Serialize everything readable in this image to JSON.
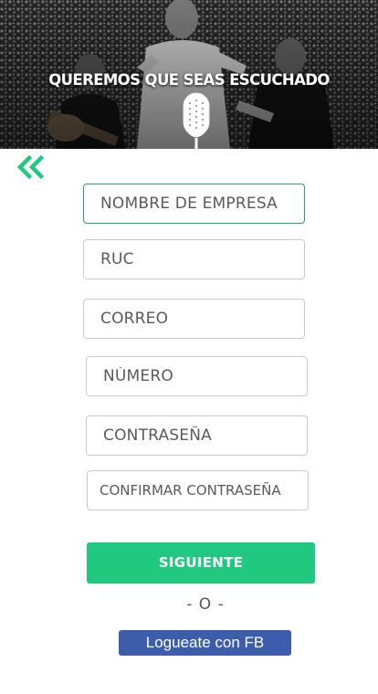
{
  "hero": {
    "title": "QUEREMOS QUE SEAS ESCUCHADO",
    "image": "mariachi-band-photo",
    "icon": "microphone-icon"
  },
  "nav": {
    "back_icon": "double-chevron-left-icon",
    "accent_color": "#21c87f"
  },
  "form": {
    "fields": [
      {
        "name": "company-name",
        "placeholder": "NOMBRE DE EMPRESA"
      },
      {
        "name": "ruc",
        "placeholder": "RUC"
      },
      {
        "name": "email",
        "placeholder": "CORREO"
      },
      {
        "name": "phone",
        "placeholder": "NÚMERO"
      },
      {
        "name": "password",
        "placeholder": "CONTRASEÑA"
      },
      {
        "name": "confirm-password",
        "placeholder": "CONFIRMAR CONTRASEÑA"
      }
    ],
    "next_label": "SIGUIENTE",
    "divider": "- O -",
    "fb_label": "Logueate con FB"
  },
  "colors": {
    "primary": "#21c87f",
    "focus_border": "#21a77a",
    "facebook": "#3b5dab"
  }
}
